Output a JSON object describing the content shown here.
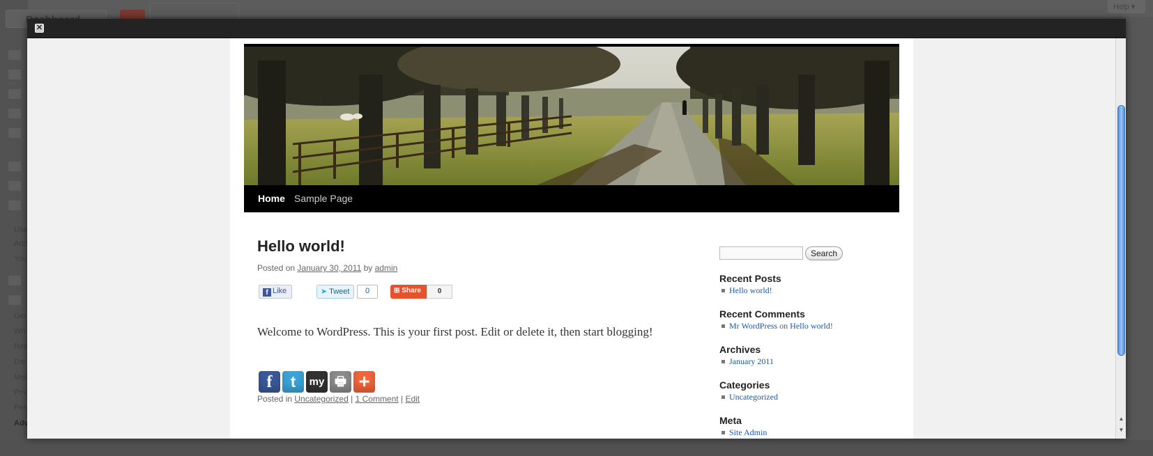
{
  "background": {
    "dashboard_label": "Dashboard",
    "help_label": "Help ▾",
    "menu_fragments": [
      "Use",
      "Add",
      "You",
      "Gen",
      "Wri",
      "Rea",
      "Dis",
      "Med",
      "Priv",
      "Pers",
      "Adv"
    ]
  },
  "modal": {
    "close_label": "✕"
  },
  "site": {
    "nav": [
      {
        "label": "Home"
      },
      {
        "label": "Sample Page"
      }
    ]
  },
  "post": {
    "title": "Hello world!",
    "meta_prefix": "Posted on",
    "date": "January 30, 2011",
    "by": "by",
    "author": "admin",
    "content": "Welcome to WordPress. This is your first post. Edit or delete it, then start blogging!",
    "social": {
      "like_label": "Like",
      "tweet_label": "Tweet",
      "tweet_count": "0",
      "share_label": "Share",
      "share_count": "0"
    },
    "share_icons": [
      {
        "name": "facebook-icon",
        "glyph": "f",
        "color": "#3b5998"
      },
      {
        "name": "twitter-icon",
        "glyph": "t",
        "color": "#3aa3d7"
      },
      {
        "name": "myspace-icon",
        "glyph": "my",
        "color": "#333333"
      },
      {
        "name": "print-icon",
        "glyph": "🖶",
        "color": "#8a8a8a"
      },
      {
        "name": "addthis-icon",
        "glyph": "+",
        "color": "#f2653a"
      }
    ],
    "footer": {
      "posted_in": "Posted in",
      "category": "Uncategorized",
      "sep1": "|",
      "comments": "1 Comment",
      "sep2": "|",
      "edit": "Edit"
    }
  },
  "sidebar": {
    "search_button": "Search",
    "recent_posts_title": "Recent Posts",
    "recent_posts": [
      "Hello world!"
    ],
    "recent_comments_title": "Recent Comments",
    "recent_comment": {
      "author": "Mr WordPress",
      "on": "on",
      "post": "Hello world!"
    },
    "archives_title": "Archives",
    "archives": [
      "January 2011"
    ],
    "categories_title": "Categories",
    "categories": [
      "Uncategorized"
    ],
    "meta_title": "Meta",
    "meta": [
      "Site Admin"
    ]
  },
  "colors": {
    "link": "#1b57b1",
    "nav_bg": "#000000",
    "scroll_thumb": "#4d8fe3"
  }
}
